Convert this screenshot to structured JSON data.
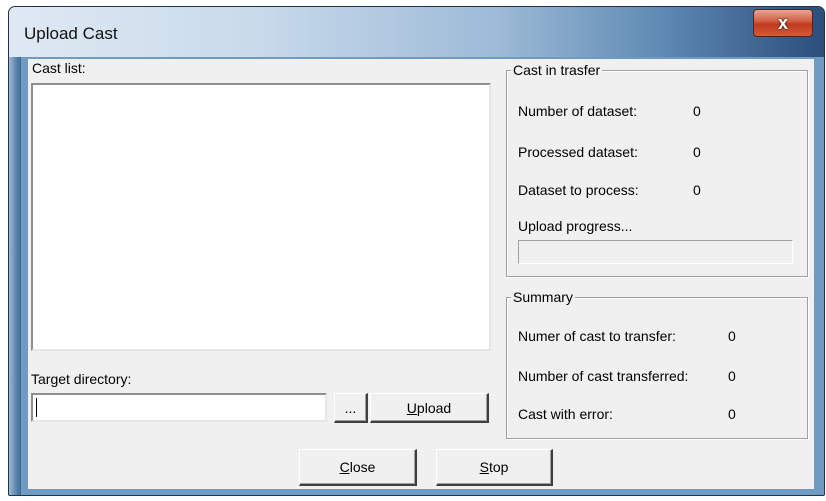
{
  "window": {
    "title": "Upload Cast",
    "close_glyph": "x"
  },
  "cast_list": {
    "label": "Cast list:",
    "items": []
  },
  "target": {
    "label": "Target directory:",
    "value": "",
    "browse_label": "...",
    "upload_label": "Upload",
    "upload_accel": "U"
  },
  "transfer_group": {
    "title": "Cast in trasfer",
    "rows": [
      {
        "label": "Number of dataset:",
        "value": "0"
      },
      {
        "label": "Processed dataset:",
        "value": "0"
      },
      {
        "label": "Dataset to process:",
        "value": "0"
      }
    ],
    "progress_label": "Upload progress...",
    "progress": 0
  },
  "summary_group": {
    "title": "Summary",
    "rows": [
      {
        "label": "Numer of cast to transfer:",
        "value": "0"
      },
      {
        "label": "Number of cast transferred:",
        "value": "0"
      },
      {
        "label": "Cast with error:",
        "value": "0"
      }
    ]
  },
  "footer": {
    "close_label": "Close",
    "close_accel": "C",
    "stop_label": "Stop",
    "stop_accel": "S"
  }
}
